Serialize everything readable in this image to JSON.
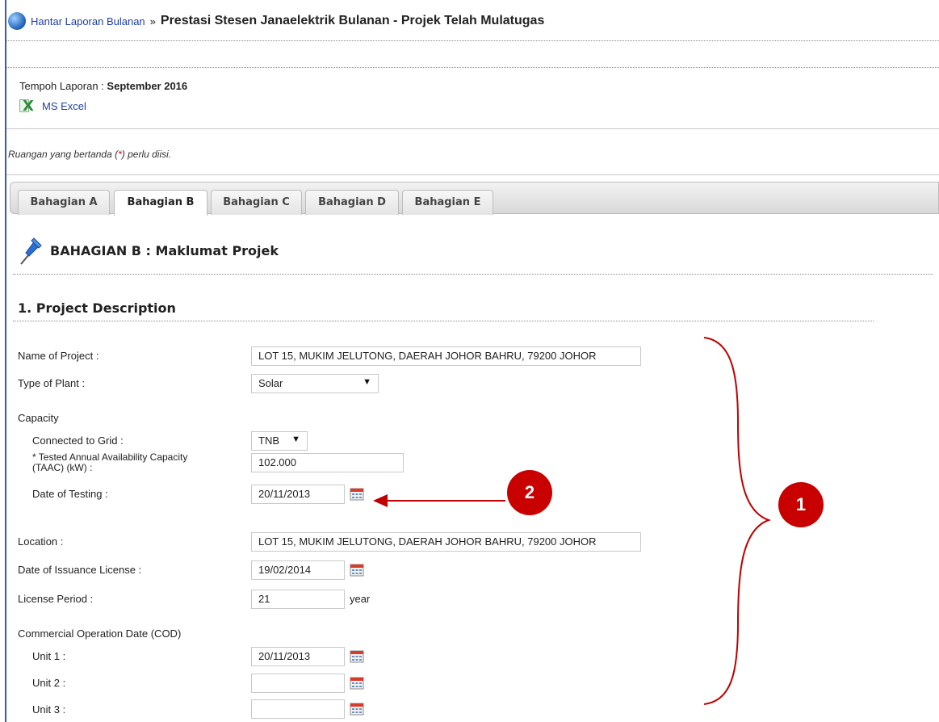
{
  "header": {
    "breadcrumb_link": "Hantar Laporan Bulanan",
    "separator": "»",
    "title": "Prestasi Stesen Janaelektrik Bulanan - Projek Telah Mulatugas"
  },
  "report_period": {
    "label": "Tempoh Laporan :",
    "value": "September 2016"
  },
  "export": {
    "excel_label": "MS Excel"
  },
  "required_note": {
    "before": "Ruangan yang bertanda (",
    "star": "*",
    "after": ") perlu diisi."
  },
  "tabs": [
    {
      "label": "Bahagian A",
      "active": false
    },
    {
      "label": "Bahagian B",
      "active": true
    },
    {
      "label": "Bahagian C",
      "active": false
    },
    {
      "label": "Bahagian D",
      "active": false
    },
    {
      "label": "Bahagian E",
      "active": false
    }
  ],
  "section": {
    "title": "BAHAGIAN B : Maklumat Projek",
    "subtitle": "1. Project Description"
  },
  "form": {
    "name_of_project": {
      "label": "Name of Project :",
      "value": "LOT 15, MUKIM JELUTONG, DAERAH JOHOR BAHRU, 79200 JOHOR"
    },
    "type_of_plant": {
      "label": "Type of Plant :",
      "value": "Solar"
    },
    "capacity": {
      "label": "Capacity"
    },
    "connected_to_grid": {
      "label": "Connected to Grid :",
      "value": "TNB"
    },
    "taac": {
      "label": "* Tested Annual Availability Capacity (TAAC) (kW) :",
      "value": "102.000"
    },
    "date_of_testing": {
      "label": "Date of Testing :",
      "value": "20/11/2013"
    },
    "location": {
      "label": "Location :",
      "value": "LOT 15, MUKIM JELUTONG, DAERAH JOHOR BAHRU, 79200 JOHOR"
    },
    "date_of_issuance_license": {
      "label": "Date of Issuance License :",
      "value": "19/02/2014"
    },
    "license_period": {
      "label": "License Period :",
      "value": "21",
      "unit": "year"
    },
    "cod": {
      "label": "Commercial Operation Date (COD)"
    },
    "unit1": {
      "label": "Unit 1 :",
      "value": "20/11/2013"
    },
    "unit2": {
      "label": "Unit 2 :",
      "value": ""
    },
    "unit3": {
      "label": "Unit 3 :",
      "value": ""
    }
  },
  "annotations": {
    "badge1": "1",
    "badge2": "2"
  },
  "colors": {
    "link": "#1f3fa8",
    "annotation_red": "#c80000",
    "frame_blue": "#3a5aa6"
  }
}
